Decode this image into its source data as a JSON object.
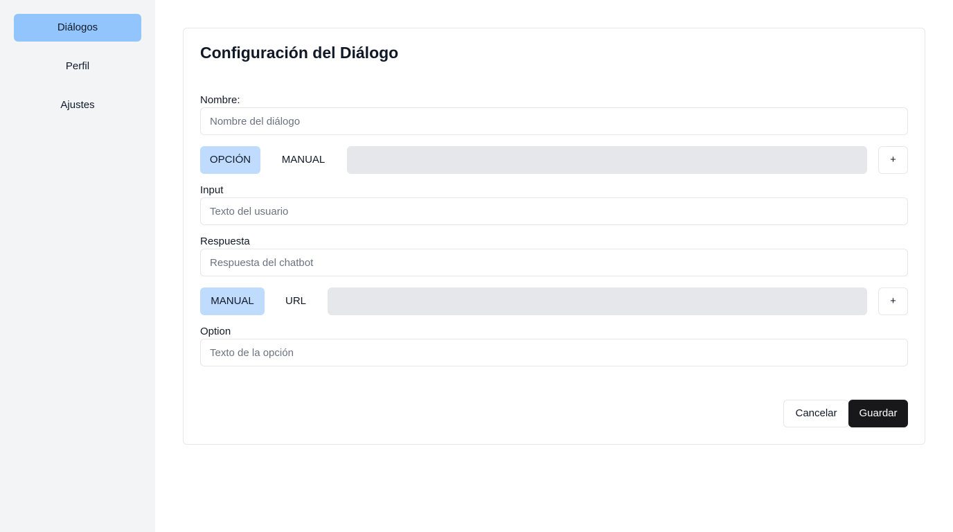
{
  "sidebar": {
    "items": [
      {
        "label": "Diálogos",
        "active": true
      },
      {
        "label": "Perfil",
        "active": false
      },
      {
        "label": "Ajustes",
        "active": false
      }
    ]
  },
  "form": {
    "title": "Configuración del Diálogo",
    "name_label": "Nombre:",
    "name_placeholder": "Nombre del diálogo",
    "toggle1": {
      "options": [
        "OPCIÓN",
        "MANUAL"
      ],
      "selected": "OPCIÓN",
      "add_label": "+"
    },
    "input_label": "Input",
    "input_placeholder": "Texto del usuario",
    "response_label": "Respuesta",
    "response_placeholder": "Respuesta del chatbot",
    "toggle2": {
      "options": [
        "MANUAL",
        "URL"
      ],
      "selected": "MANUAL",
      "add_label": "+"
    },
    "option_label": "Option",
    "option_placeholder": "Texto de la opción",
    "cancel_label": "Cancelar",
    "save_label": "Guardar"
  },
  "colors": {
    "sidebar_bg": "#f3f4f6",
    "nav_active": "#93c5fd",
    "toggle_active": "#bfdbfe",
    "track": "#e5e7eb",
    "primary_button": "#18181b"
  }
}
